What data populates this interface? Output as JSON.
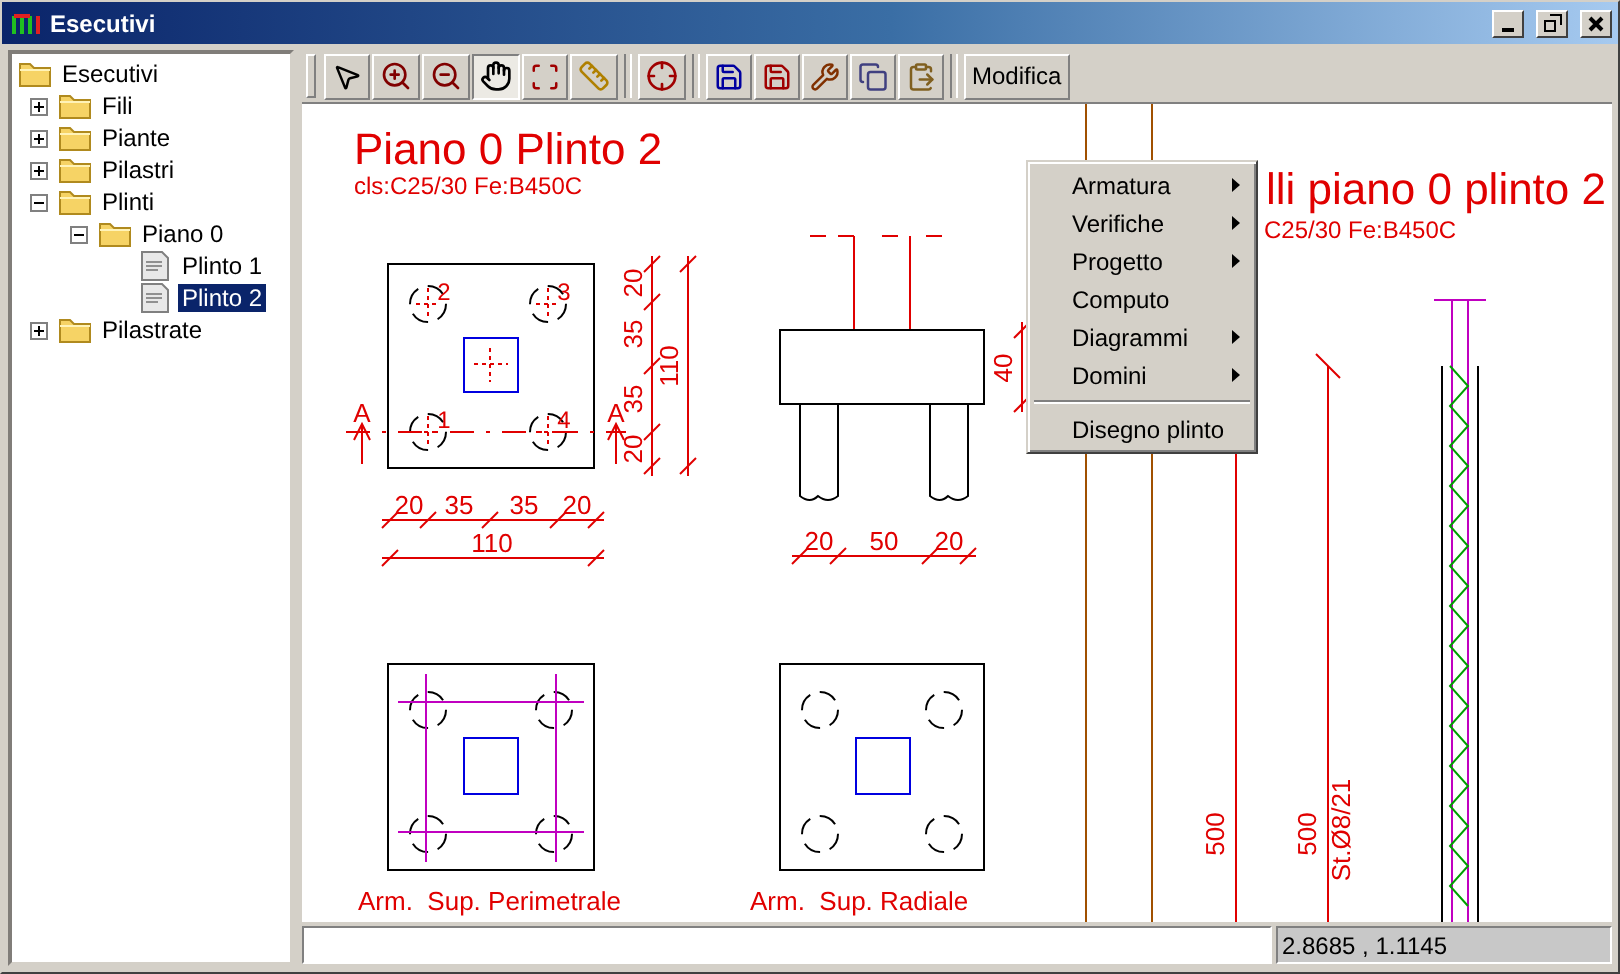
{
  "window": {
    "title": "Esecutivi"
  },
  "tree": {
    "label": "Esecutivi",
    "kind": "folder",
    "selected": false,
    "children": [
      {
        "label": "Fili",
        "kind": "folder",
        "expanded": false,
        "selected": false
      },
      {
        "label": "Piante",
        "kind": "folder",
        "expanded": false,
        "selected": false
      },
      {
        "label": "Pilastri",
        "kind": "folder",
        "expanded": false,
        "selected": false
      },
      {
        "label": "Plinti",
        "kind": "folder",
        "expanded": true,
        "selected": false,
        "children": [
          {
            "label": "Piano 0",
            "kind": "folder",
            "expanded": true,
            "selected": false,
            "children": [
              {
                "label": "Plinto 1",
                "kind": "file",
                "selected": false
              },
              {
                "label": "Plinto 2",
                "kind": "file",
                "selected": true
              }
            ]
          }
        ]
      },
      {
        "label": "Pilastrate",
        "kind": "folder",
        "expanded": false,
        "selected": false
      }
    ]
  },
  "toolbar": [
    {
      "kind": "pointer",
      "selected": false
    },
    {
      "kind": "zoom-in",
      "selected": false
    },
    {
      "kind": "zoom-out",
      "selected": false
    },
    {
      "kind": "pan",
      "selected": true
    },
    {
      "kind": "zoom-window",
      "selected": false
    },
    {
      "kind": "ruler",
      "selected": false
    },
    {
      "kind": "separator"
    },
    {
      "kind": "zoom-extents",
      "selected": false
    },
    {
      "kind": "separator"
    },
    {
      "kind": "save",
      "selected": false
    },
    {
      "kind": "save-as",
      "selected": false
    },
    {
      "kind": "tools",
      "selected": false
    },
    {
      "kind": "copy",
      "selected": false
    },
    {
      "kind": "paste",
      "selected": false
    },
    {
      "kind": "separator"
    },
    {
      "kind": "text",
      "label": "Modifica",
      "selected": false
    }
  ],
  "drawing": {
    "title": "Piano 0 Plinto 2",
    "subtitle": "cls:C25/30 Fe:B450C",
    "plan": {
      "bar_numbers": [
        "2",
        "3",
        "1",
        "4"
      ],
      "section_marks": [
        "A",
        "A"
      ],
      "vertical_dims": [
        "20",
        "35",
        "35",
        "20"
      ],
      "vertical_total": "110",
      "horizontal_dims": [
        "20",
        "35",
        "35",
        "20"
      ],
      "horizontal_total": "110"
    },
    "section": {
      "height_dim": "40",
      "bottom_dims": [
        "20",
        "50",
        "20"
      ]
    },
    "reinforcement_plans": [
      {
        "kind": "perimeter",
        "label": "Arm.  Sup. Perimetrale"
      },
      {
        "kind": "radial",
        "label": "Arm.  Sup. Radiale"
      }
    ],
    "elevation": {
      "title": "lli piano 0 plinto 2",
      "subtitle": "C25/30 Fe:B450C",
      "length_dims": [
        "500",
        "500"
      ],
      "stirrup_label": "St.Ø8/21"
    }
  },
  "context_menu": [
    {
      "kind": "item",
      "label": "Armatura",
      "submenu": true
    },
    {
      "kind": "item",
      "label": "Verifiche",
      "submenu": true
    },
    {
      "kind": "item",
      "label": "Progetto",
      "submenu": true
    },
    {
      "kind": "item",
      "label": "Computo",
      "submenu": false
    },
    {
      "kind": "item",
      "label": "Diagrammi",
      "submenu": true
    },
    {
      "kind": "item",
      "label": "Domini",
      "submenu": true
    },
    {
      "kind": "separator"
    },
    {
      "kind": "item",
      "label": "Disegno plinto",
      "submenu": false
    }
  ],
  "status_bar": {
    "coordinates": "2.8685 , 1.1145"
  }
}
